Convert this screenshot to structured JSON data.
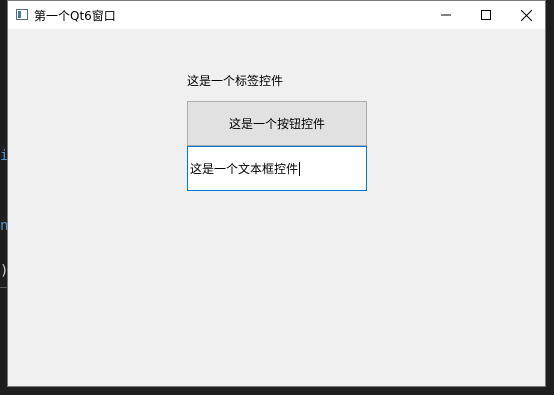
{
  "window": {
    "title": "第一个Qt6窗口",
    "controls": {
      "minimize": "minimize-icon",
      "maximize": "maximize-icon",
      "close": "close-icon"
    }
  },
  "content": {
    "label_text": "这是一个标签控件",
    "button_label": "这是一个按钮控件",
    "line_edit_value": "这是一个文本框控件"
  },
  "background": {
    "glyphs": [
      "i",
      "n",
      ")"
    ]
  },
  "colors": {
    "focus_border": "#0078d7",
    "window_bg": "#f0f0f0",
    "button_bg": "#e1e1e1"
  }
}
